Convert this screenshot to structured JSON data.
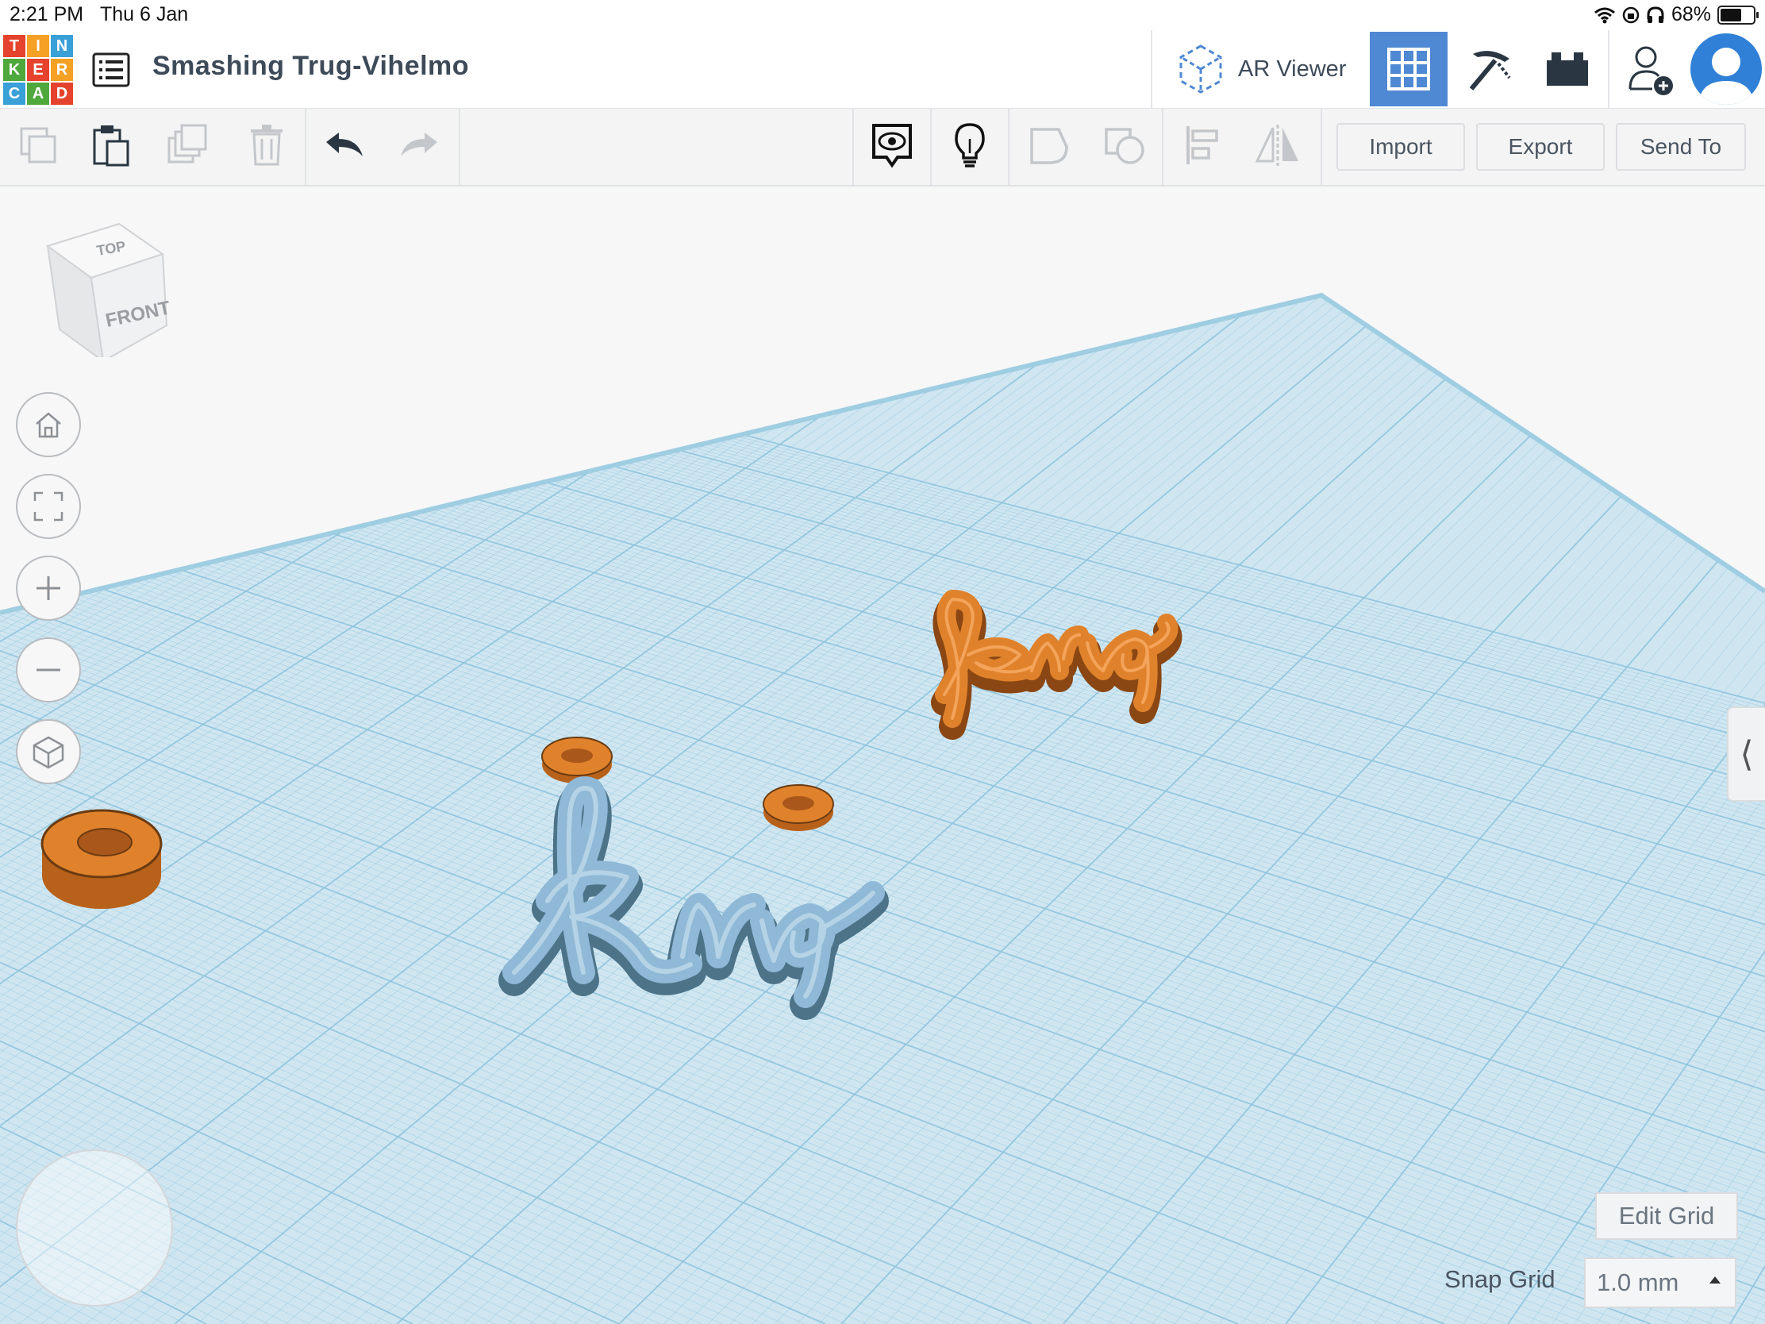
{
  "status_bar": {
    "time": "2:21 PM",
    "date": "Thu 6 Jan",
    "battery": "68%",
    "battery_level": 0.68,
    "icons": [
      "wifi-icon",
      "rotation-lock-icon",
      "headphones-icon",
      "battery-icon"
    ]
  },
  "header": {
    "logo_letters": [
      "T",
      "I",
      "N",
      "K",
      "E",
      "R",
      "C",
      "A",
      "D"
    ],
    "logo_colors": [
      "#e5432d",
      "#f4a125",
      "#3aa0d8",
      "#4fa83b",
      "#e5432d",
      "#f4a125",
      "#3aa0d8",
      "#4fa83b",
      "#e5432d"
    ],
    "design_title": "Smashing Trug-Vihelmo",
    "ar_viewer_label": "AR Viewer",
    "icons": [
      "design-list-icon",
      "ar-viewer-icon",
      "grid-view-icon",
      "blocks-view-icon",
      "bricks-view-icon",
      "add-user-icon",
      "user-avatar"
    ]
  },
  "toolbar": {
    "import_label": "Import",
    "export_label": "Export",
    "send_to_label": "Send To",
    "icons": [
      "copy-icon",
      "paste-icon",
      "duplicate-icon",
      "delete-icon",
      "undo-icon",
      "redo-icon",
      "notes-visibility-icon",
      "lightbulb-icon",
      "group-icon",
      "ungroup-icon",
      "align-icon",
      "mirror-icon"
    ]
  },
  "viewcube": {
    "top_label": "TOP",
    "front_label": "FRONT"
  },
  "nav_controls": [
    "home-view",
    "fit-view",
    "zoom-in",
    "zoom-out",
    "perspective-toggle"
  ],
  "workplane": {
    "edit_grid_label": "Edit Grid",
    "snap_grid_label": "Snap Grid",
    "snap_grid_value": "1.0 mm",
    "plane_color": "#cfe6f1",
    "gridline_color": "#8fc3dc"
  },
  "objects": {
    "orange_color": "#e0822b",
    "blue_color": "#8fb9d6",
    "shapes": [
      "orange-ring",
      "blue-king-text",
      "orange-king-text"
    ]
  }
}
